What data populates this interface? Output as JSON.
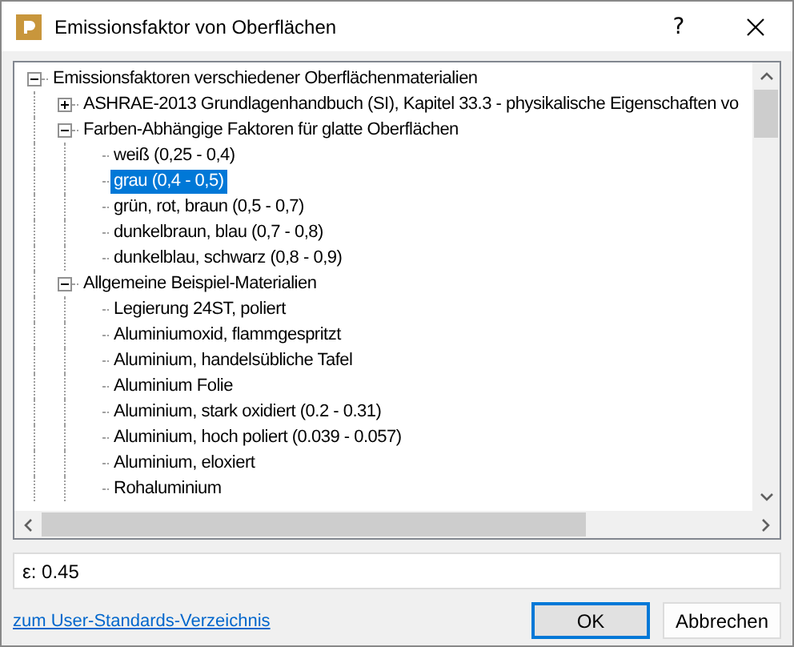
{
  "window": {
    "title": "Emissionsfaktor von Oberflächen",
    "help": "?"
  },
  "tree": [
    {
      "label": "Emissionsfaktoren verschiedener Oberflächenmaterialien",
      "expanded": true,
      "selected": false,
      "children": [
        {
          "label": "ASHRAE-2013 Grundlagenhandbuch (SI), Kapitel 33.3 - physikalische Eigenschaften vo",
          "expanded": false,
          "selected": false
        },
        {
          "label": "Farben-Abhängige Faktoren für glatte Oberflächen",
          "expanded": true,
          "selected": false,
          "children": [
            {
              "label": "weiß (0,25 - 0,4)",
              "selected": false
            },
            {
              "label": "grau (0,4 - 0,5)",
              "selected": true
            },
            {
              "label": "grün, rot, braun (0,5 - 0,7)",
              "selected": false
            },
            {
              "label": "dunkelbraun, blau (0,7 - 0,8)",
              "selected": false
            },
            {
              "label": "dunkelblau, schwarz (0,8 - 0,9)",
              "selected": false
            }
          ]
        },
        {
          "label": "Allgemeine Beispiel-Materialien",
          "expanded": true,
          "selected": false,
          "children": [
            {
              "label": "Legierung 24ST, poliert",
              "selected": false
            },
            {
              "label": "Aluminiumoxid, flammgespritzt",
              "selected": false
            },
            {
              "label": "Aluminium, handelsübliche Tafel",
              "selected": false
            },
            {
              "label": "Aluminium Folie",
              "selected": false
            },
            {
              "label": "Aluminium, stark oxidiert (0.2 - 0.31)",
              "selected": false
            },
            {
              "label": "Aluminium, hoch poliert (0.039 - 0.057)",
              "selected": false
            },
            {
              "label": "Aluminium, eloxiert",
              "selected": false
            },
            {
              "label": "Rohaluminium",
              "selected": false
            }
          ]
        }
      ]
    }
  ],
  "value_field": {
    "value": "ε: 0.45"
  },
  "link": "zum User-Standards-Verzeichnis",
  "buttons": [
    {
      "label": "OK",
      "default": true
    },
    {
      "label": "Abbrechen",
      "default": false
    }
  ]
}
